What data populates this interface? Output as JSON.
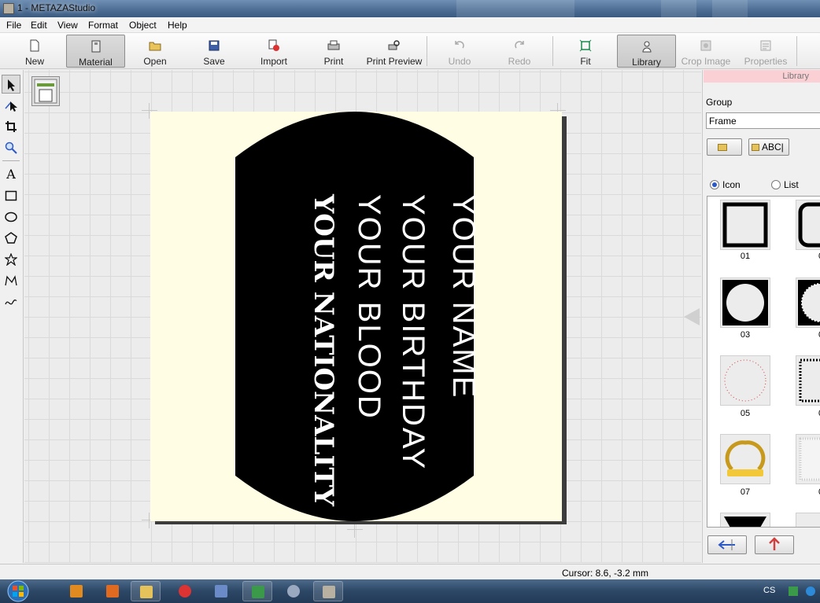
{
  "window": {
    "title": "1 - METAZAStudio"
  },
  "menu": [
    "File",
    "Edit",
    "View",
    "Format",
    "Object",
    "Help"
  ],
  "toolbar": {
    "new": "New",
    "material": "Material",
    "open": "Open",
    "save": "Save",
    "import": "Import",
    "print": "Print",
    "print_preview": "Print Preview",
    "undo": "Undo",
    "redo": "Redo",
    "fit": "Fit",
    "library": "Library",
    "crop_image": "Crop Image",
    "properties": "Properties"
  },
  "tools": {
    "text_glyph": "A"
  },
  "design": {
    "lines": [
      "YOUR NAME",
      "YOUR BIRTHDAY",
      "YOUR BLOOD",
      "YOUR NATIONALITY"
    ],
    "tag_color": "#000000",
    "material_color": "#fffde3",
    "text_color": "#ffffff"
  },
  "library": {
    "header": "Library",
    "group_label": "Group",
    "group_value": "Frame",
    "button_abc": "ABC|",
    "view_icon": "Icon",
    "view_list": "List",
    "view_selected": "Icon",
    "frames": [
      {
        "label": "01",
        "icon": "square-frame"
      },
      {
        "label": "0",
        "icon": "rounded-square-frame"
      },
      {
        "label": "03",
        "icon": "circle-frame"
      },
      {
        "label": "0",
        "icon": "ornate-circle-frame"
      },
      {
        "label": "05",
        "icon": "dotted-circle-frame"
      },
      {
        "label": "0",
        "icon": "dotted-square-frame"
      },
      {
        "label": "07",
        "icon": "laurel-wreath-frame"
      },
      {
        "label": "0",
        "icon": "light-square-frame"
      }
    ]
  },
  "status": {
    "cursor": "Cursor: 8.6, -3.2 mm"
  },
  "taskbar": {
    "language": "CS"
  },
  "colors": {
    "accent": "#3a5a80",
    "panel_header": "#fbd0d4"
  }
}
